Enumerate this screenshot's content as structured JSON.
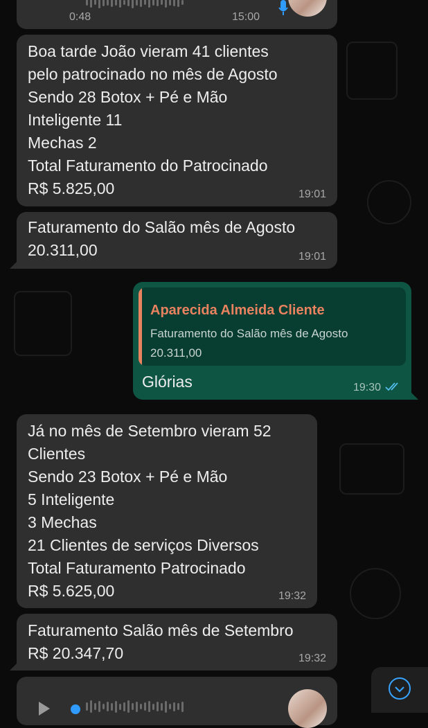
{
  "top_audio": {
    "duration": "0:48",
    "time": "15:00",
    "mic_icon": "mic-icon"
  },
  "messages": [
    {
      "text": "Boa tarde João vieram 41 clientes\npelo patrocinado no mês de Agosto\nSendo 28 Botox + Pé e Mão\nInteligente 11\nMechas 2\nTotal Faturamento do Patrocinado\nR$ 5.825,00",
      "time": "19:01"
    },
    {
      "text": "Faturamento do Salão mês de Agosto\n20.311,00",
      "time": "19:01"
    },
    {
      "quote_author": "Aparecida Almeida Cliente",
      "quote_text": "Faturamento do Salão mês de Agosto\n20.311,00",
      "text": "Glórias",
      "time": "19:30",
      "status_icon": "double-check-read-icon"
    },
    {
      "text": "Já no mês de Setembro vieram 52\nClientes\nSendo 23 Botox + Pé e Mão\n5 Inteligente\n3 Mechas\n21 Clientes de serviços Diversos\nTotal Faturamento Patrocinado\nR$ 5.625,00",
      "time": "19:32"
    },
    {
      "text": "Faturamento Salão mês de Setembro\nR$ 20.347,70",
      "time": "19:32"
    }
  ],
  "colors": {
    "incoming_bubble": "#2f2f2f",
    "outgoing_bubble": "#0e5544",
    "quote_author": "#e8825f",
    "read_check": "#53bdeb",
    "scroll_button_accent": "#36a3ff"
  }
}
